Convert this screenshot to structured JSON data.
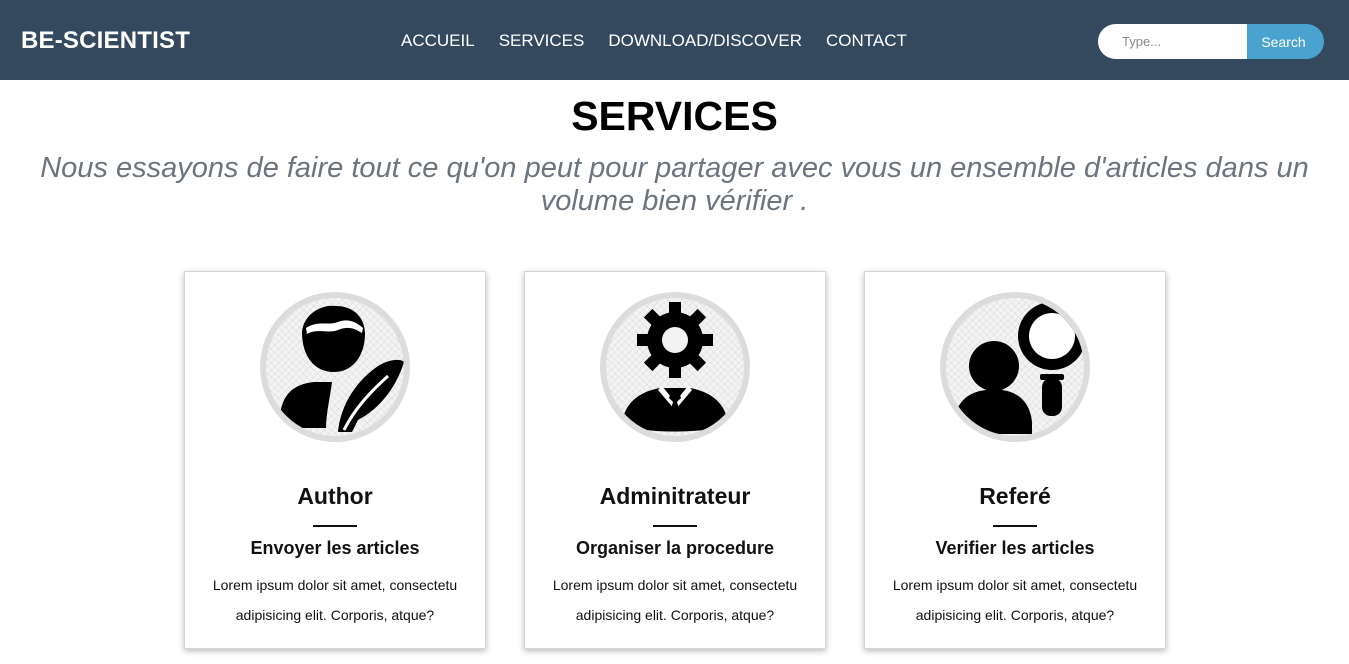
{
  "navbar": {
    "brand": "BE-SCIENTIST",
    "links": [
      "ACCUEIL",
      "SERVICES",
      "DOWNLOAD/DISCOVER",
      "CONTACT"
    ],
    "search": {
      "placeholder": "Type...",
      "button_label": "Search"
    },
    "background_color": "#34495e",
    "search_button_color": "#4aa3cf"
  },
  "services": {
    "title": "SERVICES",
    "lead": "Nous essayons de faire tout ce qu'on peut pour partager avec vous un ensemble d'articles dans un volume bien vérifier .",
    "cards": [
      {
        "icon": "author-quill-icon",
        "title": "Author",
        "subtitle": "Envoyer les articles",
        "text": "Lorem ipsum dolor sit amet, consectetu adipisicing elit. Corporis, atque?"
      },
      {
        "icon": "admin-gear-icon",
        "title": "Adminitrateur",
        "subtitle": "Organiser la procedure",
        "text": "Lorem ipsum dolor sit amet, consectetu adipisicing elit. Corporis, atque?"
      },
      {
        "icon": "reviewer-magnifier-icon",
        "title": "Referé",
        "subtitle": "Verifier les articles",
        "text": "Lorem ipsum dolor sit amet, consectetu adipisicing elit. Corporis, atque?"
      }
    ]
  }
}
